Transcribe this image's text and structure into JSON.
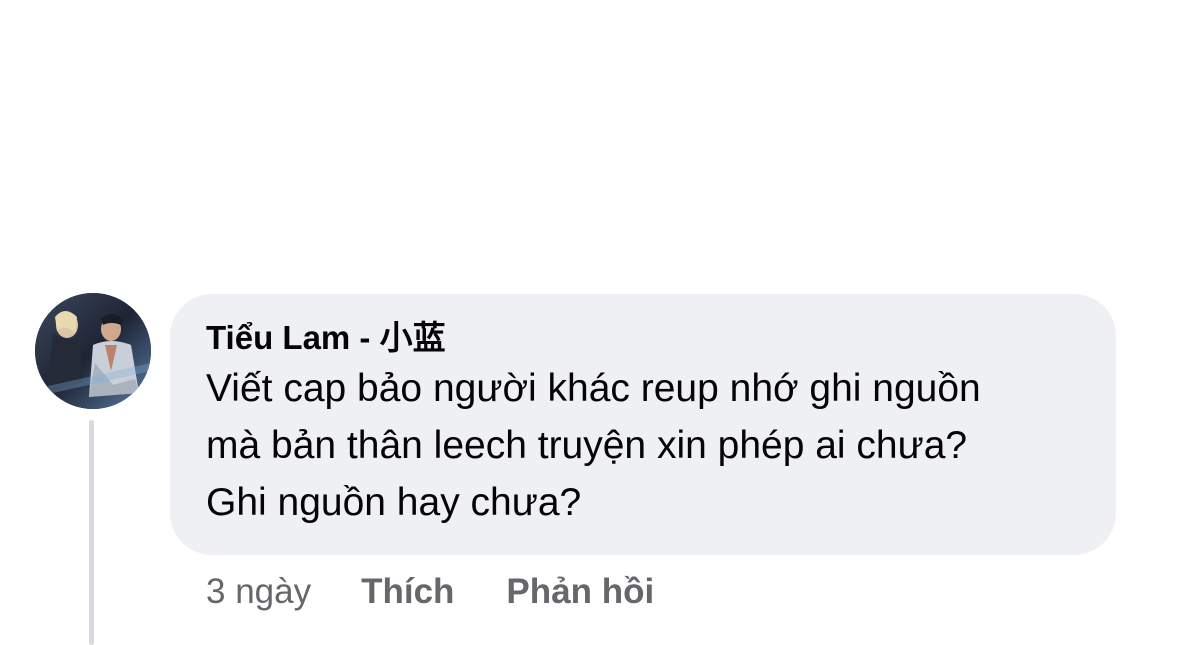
{
  "comment": {
    "author_name": "Tiểu Lam - 小蓝",
    "text": "Viết cap bảo người khác reup nhớ ghi nguồn\nmà bản thân leech truyện xin phép ai chưa?\nGhi nguồn hay chưa?",
    "avatar": "user-avatar-image"
  },
  "actions": {
    "time": "3 ngày",
    "like_label": "Thích",
    "reply_label": "Phản hồi"
  },
  "colors": {
    "bubble_bg": "#eff0f3",
    "text": "#050505",
    "secondary_text": "#65676b",
    "thread_line": "#d7dadf"
  }
}
